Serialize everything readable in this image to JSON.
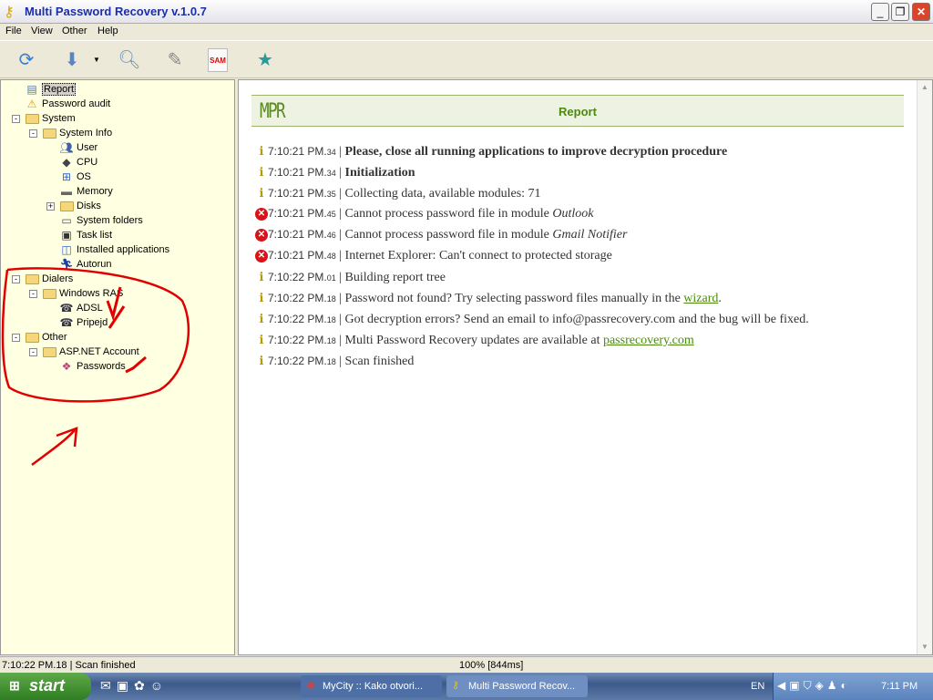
{
  "window": {
    "title": "Multi Password Recovery v.1.0.7"
  },
  "menu": [
    "File",
    "View",
    "Other",
    "Help"
  ],
  "toolbar": [
    {
      "icon": "refresh-icon"
    },
    {
      "icon": "save-report-icon"
    },
    {
      "icon": "dropdown-arrow-icon"
    },
    {
      "icon": "search-icon"
    },
    {
      "icon": "edit-icon"
    },
    {
      "icon": "sam-icon",
      "label": "SAM"
    },
    {
      "icon": "star-icon"
    }
  ],
  "tree": [
    {
      "label": "Report",
      "level": 0,
      "icon": "report-icon",
      "selected": true
    },
    {
      "label": "Password audit",
      "level": 0,
      "icon": "warning-icon"
    },
    {
      "label": "System",
      "level": 0,
      "icon": "folder-icon",
      "expander": "-"
    },
    {
      "label": "System Info",
      "level": 1,
      "icon": "folder-icon",
      "expander": "-"
    },
    {
      "label": "User",
      "level": 2,
      "icon": "user-icon"
    },
    {
      "label": "CPU",
      "level": 2,
      "icon": "cpu-icon"
    },
    {
      "label": "OS",
      "level": 2,
      "icon": "os-icon"
    },
    {
      "label": "Memory",
      "level": 2,
      "icon": "memory-icon"
    },
    {
      "label": "Disks",
      "level": 2,
      "icon": "folder-icon",
      "expander": "+"
    },
    {
      "label": "System folders",
      "level": 2,
      "icon": "system-folders-icon"
    },
    {
      "label": "Task list",
      "level": 2,
      "icon": "task-list-icon"
    },
    {
      "label": "Installed applications",
      "level": 2,
      "icon": "installed-apps-icon"
    },
    {
      "label": "Autorun",
      "level": 2,
      "icon": "autorun-icon"
    },
    {
      "label": "Dialers",
      "level": 0,
      "icon": "folder-icon",
      "expander": "-"
    },
    {
      "label": "Windows RAS",
      "level": 1,
      "icon": "folder-icon",
      "expander": "-"
    },
    {
      "label": "ADSL",
      "level": 2,
      "icon": "dialer-icon"
    },
    {
      "label": "Pripejd",
      "level": 2,
      "icon": "dialer-icon"
    },
    {
      "label": "Other",
      "level": 0,
      "icon": "folder-icon",
      "expander": "-"
    },
    {
      "label": "ASP.NET Account",
      "level": 1,
      "icon": "folder-icon",
      "expander": "-"
    },
    {
      "label": "Passwords",
      "level": 2,
      "icon": "passwords-icon"
    }
  ],
  "report": {
    "logo": "MPR",
    "title": "Report",
    "lines": [
      {
        "type": "info",
        "time": "7:10:21 PM.",
        "ms": "34",
        "text": "Please, close all running applications to improve decryption procedure",
        "bold": true
      },
      {
        "type": "info",
        "time": "7:10:21 PM.",
        "ms": "34",
        "text": "Initialization",
        "bold": true
      },
      {
        "type": "info",
        "time": "7:10:21 PM.",
        "ms": "35",
        "text": "Collecting data, available modules: 71"
      },
      {
        "type": "error",
        "time": "7:10:21 PM.",
        "ms": "45",
        "text": "Cannot process password file in module ",
        "em": "Outlook"
      },
      {
        "type": "error",
        "time": "7:10:21 PM.",
        "ms": "46",
        "text": "Cannot process password file in module ",
        "em": "Gmail Notifier"
      },
      {
        "type": "error",
        "time": "7:10:21 PM.",
        "ms": "48",
        "text": "Internet Explorer: Can't connect to protected storage"
      },
      {
        "type": "info",
        "time": "7:10:22 PM.",
        "ms": "01",
        "text": "Building report tree"
      },
      {
        "type": "info",
        "time": "7:10:22 PM.",
        "ms": "18",
        "text": "Password not found? Try selecting password files manually in the ",
        "link": "wizard",
        "after": "."
      },
      {
        "type": "info",
        "time": "7:10:22 PM.",
        "ms": "18",
        "text": "Got decryption errors? Send an email to info@passrecovery.com and the bug will be fixed."
      },
      {
        "type": "info",
        "time": "7:10:22 PM.",
        "ms": "18",
        "text": "Multi Password Recovery updates are available at ",
        "link": "passrecovery.com"
      },
      {
        "type": "info",
        "time": "7:10:22 PM.",
        "ms": "18",
        "text": "Scan finished"
      }
    ]
  },
  "status": {
    "left": "7:10:22 PM.18 | Scan finished",
    "right": "100% [844ms]"
  },
  "taskbar": {
    "start": "start",
    "tasks": [
      "MyCity :: Kako otvori...",
      "Multi Password Recov..."
    ],
    "lang": "EN",
    "clock": "7:11 PM"
  },
  "colors": {
    "accent": "#4b8a0e",
    "error": "#d8141a",
    "annotation": "#e00000"
  }
}
